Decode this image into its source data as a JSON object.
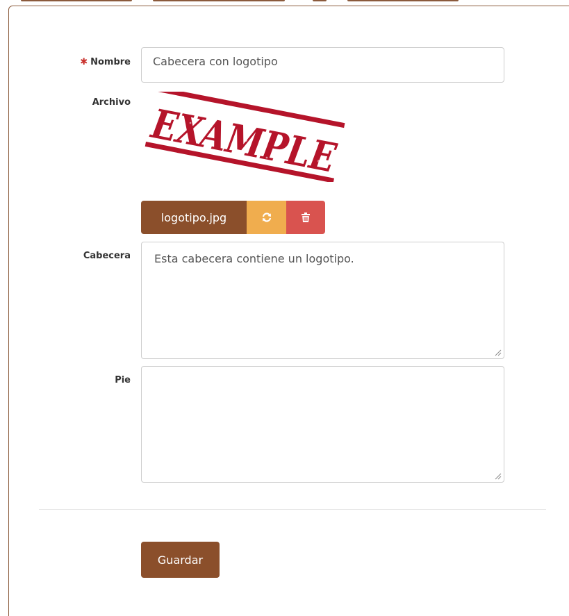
{
  "form": {
    "nombre": {
      "label": "Nombre",
      "required_mark": "✱",
      "value": "Cabecera con logotipo"
    },
    "archivo": {
      "label": "Archivo",
      "image_text": "EXAMPLE",
      "file_name": "logotipo.jpg",
      "reload_icon": "refresh-icon",
      "delete_icon": "trash-icon"
    },
    "cabecera": {
      "label": "Cabecera",
      "value": "Esta cabecera contiene un logotipo."
    },
    "pie": {
      "label": "Pie",
      "value": ""
    },
    "save_label": "Guardar"
  },
  "colors": {
    "brand": "#8b4f2b",
    "warning": "#f0ad4e",
    "danger": "#d9534f",
    "required": "#c9302c",
    "stamp": "#b5142a"
  }
}
